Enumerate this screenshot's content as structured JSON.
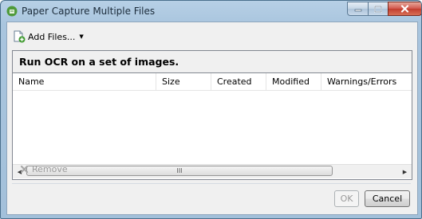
{
  "window": {
    "title": "Paper Capture Multiple Files"
  },
  "toolbar": {
    "add_files_label": "Add Files..."
  },
  "panel": {
    "heading": "Run OCR on a set of images.",
    "columns": [
      "Name",
      "Size",
      "Created",
      "Modified",
      "Warnings/Errors"
    ],
    "scroll_thumb_grip": "III"
  },
  "actions": {
    "remove_label": "Remove",
    "ok_label": "OK",
    "cancel_label": "Cancel"
  }
}
